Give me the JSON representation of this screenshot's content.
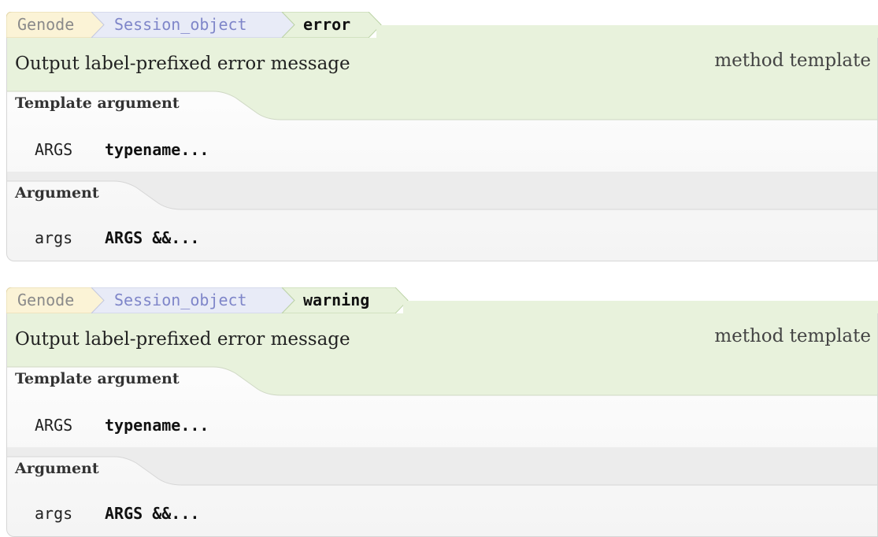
{
  "entries": [
    {
      "breadcrumb": [
        "Genode",
        "Session_object",
        "error"
      ],
      "summary": "Output label-prefixed error message",
      "kind": "method template",
      "template_section": "Template argument",
      "template_args": [
        {
          "name": "ARGS",
          "type": "typename..."
        }
      ],
      "argument_section": "Argument",
      "arguments": [
        {
          "name": "args",
          "type": "ARGS &&..."
        }
      ]
    },
    {
      "breadcrumb": [
        "Genode",
        "Session_object",
        "warning"
      ],
      "summary": "Output label-prefixed error message",
      "kind": "method template",
      "template_section": "Template argument",
      "template_args": [
        {
          "name": "ARGS",
          "type": "typename..."
        }
      ],
      "argument_section": "Argument",
      "arguments": [
        {
          "name": "args",
          "type": "ARGS &&..."
        }
      ]
    }
  ],
  "colors": {
    "crumb_genode_bg": "#fbf3d6",
    "crumb_session_bg": "#e8ebf7",
    "crumb_method_bg": "#e8f2dc",
    "header_bg": "#e8f2dc",
    "section_bg": "#ececec",
    "card_border": "#d6d6d6"
  }
}
